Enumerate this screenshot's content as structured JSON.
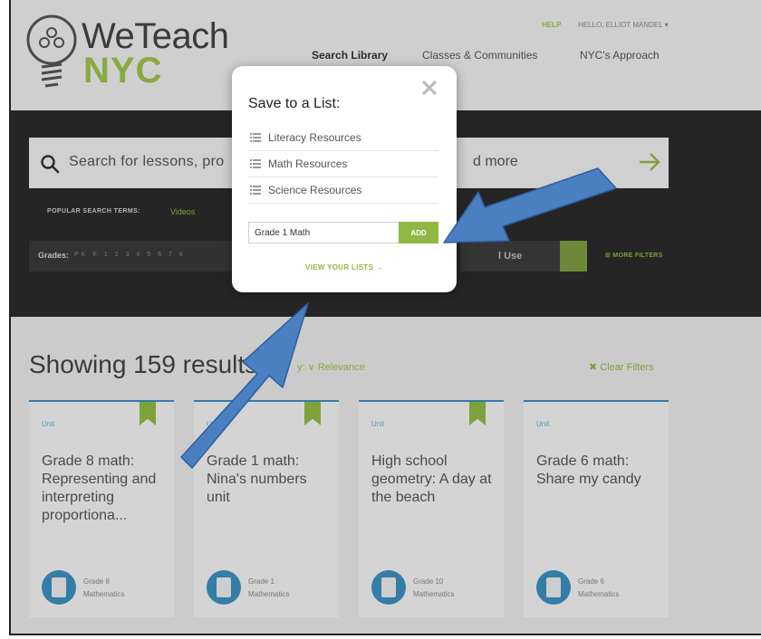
{
  "header": {
    "logo_text_top": "WeTeach",
    "logo_text_bottom": "NYC",
    "help_link": "HELP",
    "user_menu": "HELLO, ELLIOT MANDEL ▾",
    "nav": {
      "search_library": "Search Library",
      "classes_communities": "Classes & Communities",
      "nyc_approach": "NYC's Approach"
    }
  },
  "search": {
    "placeholder_visible": "Search for lessons, pro",
    "placeholder_tail": "d more",
    "popular_label": "POPULAR SEARCH TERMS:",
    "popular_terms": [
      "Videos"
    ],
    "grades_label": "Grades:",
    "grades": [
      "PK",
      "K",
      "1",
      "2",
      "3",
      "4",
      "5",
      "6",
      "7",
      "8"
    ],
    "use_select_label": "l Use",
    "more_filters": "MORE FILTERS"
  },
  "results": {
    "heading": "Showing 159 results",
    "sort_label": "y: ∨ Relevance",
    "clear_filters": "✖ Clear Filters",
    "cards": [
      {
        "type": "Unit",
        "title": "Grade 8 math: Representing and interpreting proportiona...",
        "grade": "Grade 8",
        "subject": "Mathematics",
        "bookmarked": true
      },
      {
        "type": "Unit",
        "title": "Grade 1 math: Nina's numbers unit",
        "grade": "Grade 1",
        "subject": "Mathematics",
        "bookmarked": true
      },
      {
        "type": "Unit",
        "title": "High school geometry: A day at the beach",
        "grade": "Grade 10",
        "subject": "Mathematics",
        "bookmarked": true
      },
      {
        "type": "Unit",
        "title": "Grade 6 math: Share my candy",
        "grade": "Grade 6",
        "subject": "Mathematics",
        "bookmarked": false
      }
    ]
  },
  "modal": {
    "title": "Save to a List:",
    "lists": [
      "Literacy Resources",
      "Math Resources",
      "Science Resources"
    ],
    "new_list_value": "Grade 1 Math",
    "add_label": "ADD",
    "view_lists_label": "VIEW YOUR LISTS →"
  },
  "colors": {
    "accent_green": "#8fb844",
    "card_blue": "#3c8fbf",
    "arrow_blue": "#4a7fc1",
    "dark_band": "#2b2b2b"
  }
}
